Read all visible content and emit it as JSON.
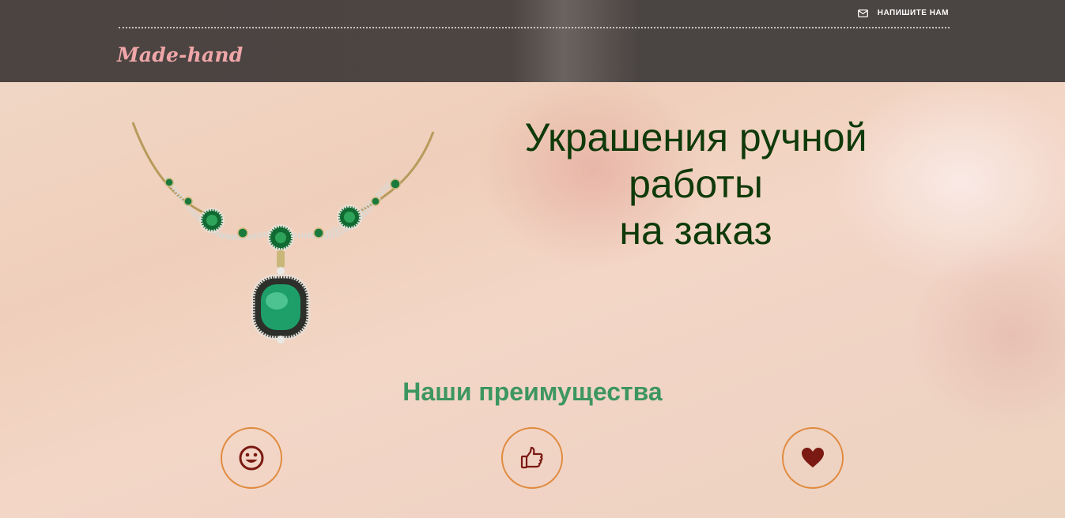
{
  "header": {
    "contact_label": "НАПИШИТЕ НАМ",
    "contact_icon": "mail-icon",
    "logo": "Made-hand"
  },
  "hero": {
    "title_lines": [
      "Украшения ручной",
      "работы",
      "на заказ"
    ],
    "image": "emerald-necklace"
  },
  "advantages": {
    "title": "Наши преимущества",
    "icons": [
      "smile-icon",
      "thumbs-up-icon",
      "heart-icon"
    ]
  },
  "colors": {
    "header_bg": "#4b4441",
    "logo": "#f0a6a8",
    "hero_title": "#0f3a0a",
    "section_title": "#3d9660",
    "circle_border": "#e08a3f",
    "icon": "#7a1a12"
  }
}
